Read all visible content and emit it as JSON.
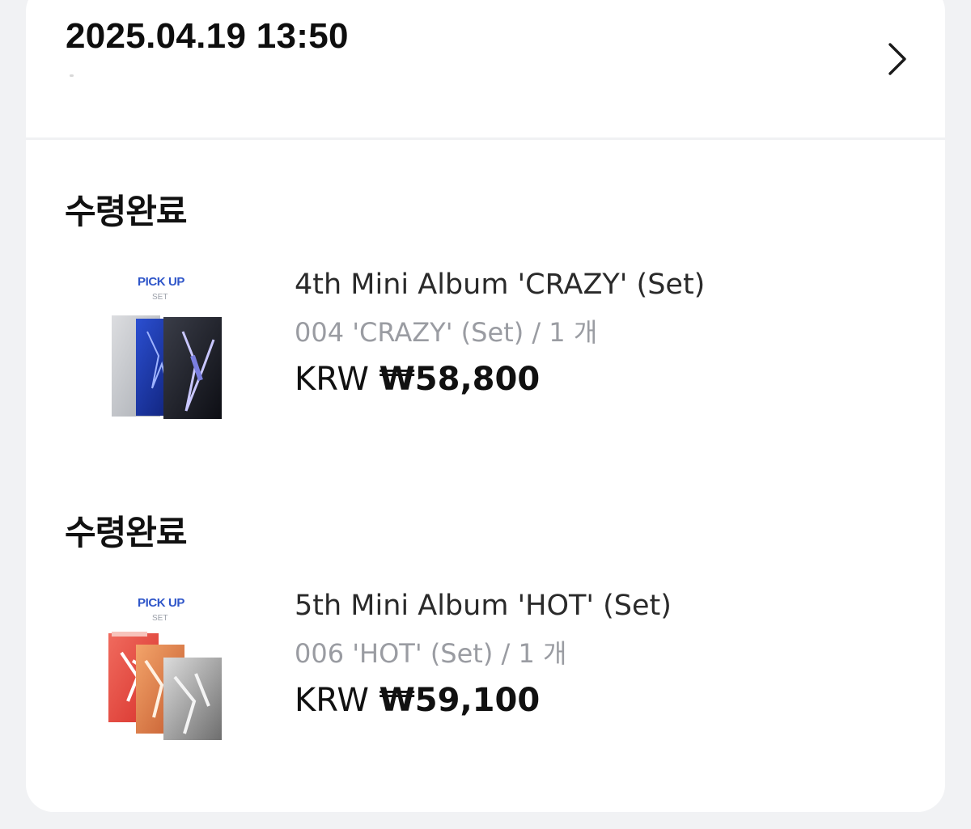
{
  "order": {
    "datetime": "2025.04.19 13:50"
  },
  "items": [
    {
      "status": "수령완료",
      "thumb_badge": "PICK UP",
      "thumb_sub": "SET",
      "title": "4th Mini Album 'CRAZY' (Set)",
      "option": "004 'CRAZY' (Set) / 1 개",
      "currency": "KRW",
      "price": "₩58,800"
    },
    {
      "status": "수령완료",
      "thumb_badge": "PICK UP",
      "thumb_sub": "SET",
      "title": "5th Mini Album 'HOT' (Set)",
      "option": "006 'HOT' (Set) / 1 개",
      "currency": "KRW",
      "price": "₩59,100"
    }
  ],
  "icons": {
    "detail": "chevron-right-icon"
  },
  "colors": {
    "badge": "#2f56c9",
    "option_text": "#9a9ca2"
  }
}
